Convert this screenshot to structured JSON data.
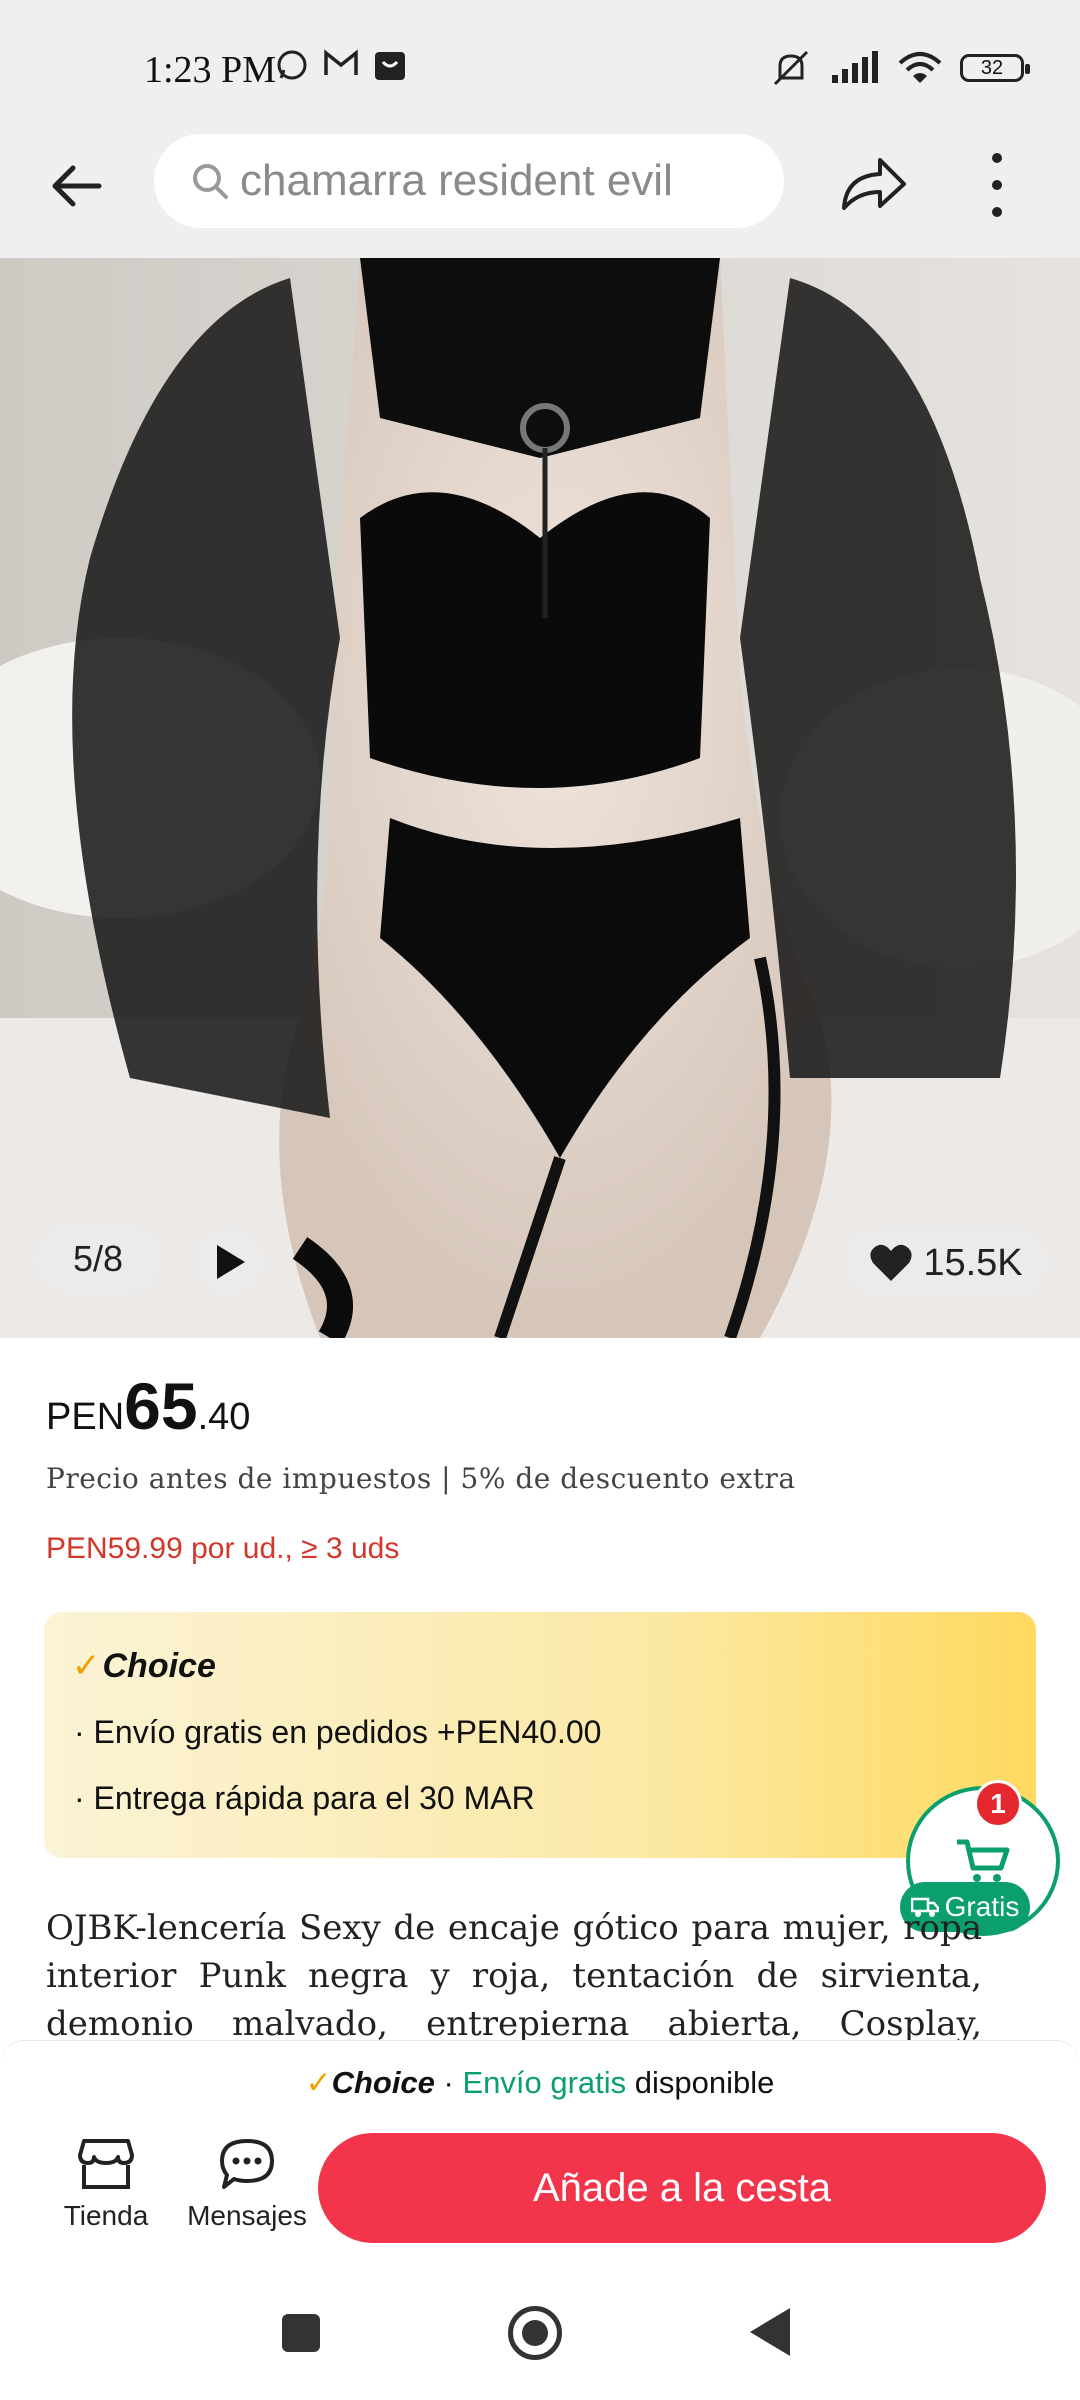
{
  "status_bar": {
    "time": "1:23 PM",
    "battery": "32"
  },
  "header": {
    "search_placeholder": "chamarra resident evil"
  },
  "image": {
    "counter": "5/8",
    "likes": "15.5K"
  },
  "price": {
    "currency": "PEN",
    "integer": "65",
    "decimal": ".40",
    "tax_note": "Precio antes de impuestos | 5% de descuento extra",
    "bulk_offer": "PEN59.99 por ud., ≥ 3 uds"
  },
  "choice": {
    "logo_check": "✓",
    "logo_text": "Choice",
    "lines": [
      "· Envío gratis en pedidos +PEN40.00",
      "· Entrega rápida para el 30 MAR"
    ]
  },
  "cart_fab": {
    "badge": "1",
    "label": "Gratis"
  },
  "product_title": "OJBK-lencería Sexy de encaje gótico para mujer, ropa interior Punk negra y roja, tentación de sirvienta, demonio malvado, entrepierna abierta, Cosplay, vestido",
  "bottom": {
    "choice_strip": {
      "check": "✓",
      "choice": "Choice",
      "sep": " · ",
      "free": "Envío gratis",
      "available": " disponible"
    },
    "store_label": "Tienda",
    "messages_label": "Mensajes",
    "add_to_cart": "Añade a la cesta"
  },
  "colors": {
    "accent": "#f2354b",
    "price_red": "#d2372b",
    "green": "#0a9f6b",
    "choice_gold": "#f0a000"
  }
}
